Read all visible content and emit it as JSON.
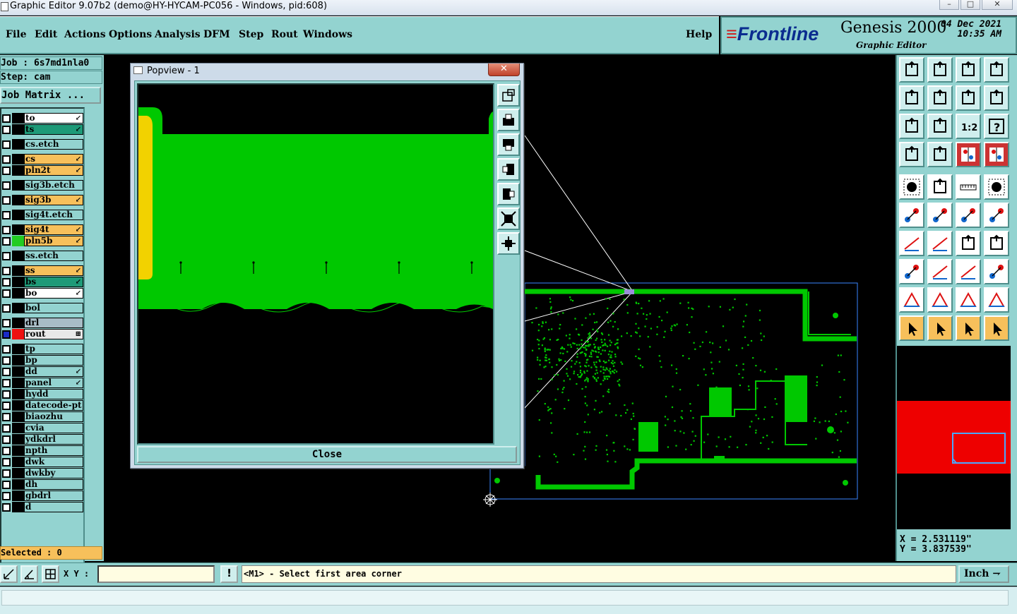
{
  "window": {
    "title": "Graphic Editor 9.07b2 (demo@HY-HYCAM-PC056 - Windows, pid:608)",
    "controls": [
      "–",
      "□",
      "✕"
    ]
  },
  "menu": {
    "file": "File",
    "edit": "Edit",
    "actions": "Actions",
    "options": "Options",
    "analysis": "Analysis",
    "dfm": "DFM",
    "step": "Step",
    "rout": "Rout",
    "windows": "Windows",
    "help": "Help"
  },
  "brand": {
    "logo_prefix": "≡",
    "logo": "Frontline",
    "product": "Genesis 2000",
    "subtitle": "Graphic Editor",
    "date": "04 Dec 2021",
    "time": "10:35 AM"
  },
  "left": {
    "job": "Job : 6s7md1nla0",
    "step": "Step: cam",
    "job_matrix": "Job Matrix ...",
    "selected": "Selected : 0",
    "layers": [
      {
        "name": "to",
        "color": "#ffffff",
        "swatch": "#000000",
        "arrow": "↙"
      },
      {
        "name": "ts",
        "color": "#1e9a78",
        "swatch": "#000000",
        "arrow": "↙"
      },
      {
        "name": "cs.etch",
        "color": "#93d3d0",
        "swatch": "#000000",
        "arrow": ""
      },
      {
        "name": "cs",
        "color": "#f7c05b",
        "swatch": "#000000",
        "arrow": "↙"
      },
      {
        "name": "pln2t",
        "color": "#f7c05b",
        "swatch": "#000000",
        "arrow": "↙"
      },
      {
        "name": "sig3b.etch",
        "color": "#93d3d0",
        "swatch": "#000000",
        "arrow": ""
      },
      {
        "name": "sig3b",
        "color": "#f7c05b",
        "swatch": "#000000",
        "arrow": "↙"
      },
      {
        "name": "sig4t.etch",
        "color": "#93d3d0",
        "swatch": "#000000",
        "arrow": ""
      },
      {
        "name": "sig4t",
        "color": "#f7c05b",
        "swatch": "#000000",
        "arrow": "↙"
      },
      {
        "name": "pln5b",
        "color": "#f7c05b",
        "swatch": "#22cc22",
        "arrow": "↙"
      },
      {
        "name": "ss.etch",
        "color": "#93d3d0",
        "swatch": "#000000",
        "arrow": ""
      },
      {
        "name": "ss",
        "color": "#f7c05b",
        "swatch": "#000000",
        "arrow": "↙"
      },
      {
        "name": "bs",
        "color": "#1e9a78",
        "swatch": "#000000",
        "arrow": "↙"
      },
      {
        "name": "bo",
        "color": "#ffffff",
        "swatch": "#000000",
        "arrow": "↙"
      },
      {
        "name": "bol",
        "color": "#93d3d0",
        "swatch": "#000000",
        "arrow": ""
      },
      {
        "name": "drl",
        "color": "#a8bcc6",
        "swatch": "#000000",
        "arrow": ""
      },
      {
        "name": "rout",
        "color": "#e8e8e8",
        "swatch": "#ee1111",
        "arrow": "⊞"
      },
      {
        "name": "tp",
        "color": "#93d3d0",
        "swatch": "#000000",
        "arrow": ""
      },
      {
        "name": "bp",
        "color": "#93d3d0",
        "swatch": "#000000",
        "arrow": ""
      },
      {
        "name": "dd",
        "color": "#93d3d0",
        "swatch": "#000000",
        "arrow": "↙"
      },
      {
        "name": "panel",
        "color": "#93d3d0",
        "swatch": "#000000",
        "arrow": "↙"
      },
      {
        "name": "hydd",
        "color": "#93d3d0",
        "swatch": "#000000",
        "arrow": ""
      },
      {
        "name": "datecode-pt",
        "color": "#93d3d0",
        "swatch": "#000000",
        "arrow": ""
      },
      {
        "name": "biaozhu",
        "color": "#93d3d0",
        "swatch": "#000000",
        "arrow": ""
      },
      {
        "name": "cvia",
        "color": "#93d3d0",
        "swatch": "#000000",
        "arrow": ""
      },
      {
        "name": "ydkdrl",
        "color": "#93d3d0",
        "swatch": "#000000",
        "arrow": ""
      },
      {
        "name": "npth",
        "color": "#93d3d0",
        "swatch": "#000000",
        "arrow": ""
      },
      {
        "name": "dwk",
        "color": "#93d3d0",
        "swatch": "#000000",
        "arrow": ""
      },
      {
        "name": "dwkby",
        "color": "#93d3d0",
        "swatch": "#000000",
        "arrow": ""
      },
      {
        "name": "dh",
        "color": "#93d3d0",
        "swatch": "#000000",
        "arrow": ""
      },
      {
        "name": "gbdrl",
        "color": "#93d3d0",
        "swatch": "#000000",
        "arrow": ""
      },
      {
        "name": "d",
        "color": "#93d3d0",
        "swatch": "#000000",
        "arrow": ""
      }
    ]
  },
  "popup": {
    "title": "Popview - 1",
    "close_x": "✕",
    "close": "Close"
  },
  "right": {
    "x": "X = 2.531119\"",
    "y": "Y = 3.837539\""
  },
  "status": {
    "xy_label": "X Y :",
    "xy_value": "",
    "warn": "!",
    "message": "<M1> - Select first area corner",
    "unit": "Inch",
    "unit_arrow": "⇁"
  },
  "colors": {
    "panel": "#93d3d0",
    "board": "#00c800",
    "gold": "#f2d200",
    "highlight": "#f7c05b"
  }
}
